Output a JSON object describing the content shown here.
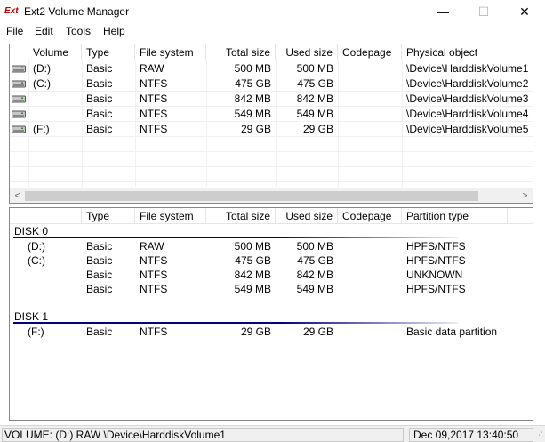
{
  "window": {
    "app_icon_text": "Ext",
    "title": "Ext2 Volume Manager",
    "min_glyph": "—",
    "max_glyph": "☐",
    "close_glyph": "✕"
  },
  "menu": [
    "File",
    "Edit",
    "Tools",
    "Help"
  ],
  "volumes": {
    "columns": [
      "Volume",
      "Type",
      "File system",
      "Total size",
      "Used size",
      "Codepage",
      "Physical object"
    ],
    "rows": [
      {
        "volume": "(D:)",
        "type": "Basic",
        "fs": "RAW",
        "total": "500 MB",
        "used": "500 MB",
        "codepage": "",
        "physical": "\\Device\\HarddiskVolume1"
      },
      {
        "volume": "(C:)",
        "type": "Basic",
        "fs": "NTFS",
        "total": "475 GB",
        "used": "475 GB",
        "codepage": "",
        "physical": "\\Device\\HarddiskVolume2"
      },
      {
        "volume": "",
        "type": "Basic",
        "fs": "NTFS",
        "total": "842 MB",
        "used": "842 MB",
        "codepage": "",
        "physical": "\\Device\\HarddiskVolume3"
      },
      {
        "volume": "",
        "type": "Basic",
        "fs": "NTFS",
        "total": "549 MB",
        "used": "549 MB",
        "codepage": "",
        "physical": "\\Device\\HarddiskVolume4"
      },
      {
        "volume": "(F:)",
        "type": "Basic",
        "fs": "NTFS",
        "total": "29 GB",
        "used": "29 GB",
        "codepage": "",
        "physical": "\\Device\\HarddiskVolume5"
      }
    ]
  },
  "scroll": {
    "left_arrow": "<",
    "right_arrow": ">"
  },
  "disks": {
    "columns": [
      "",
      "Type",
      "File system",
      "Total size",
      "Used size",
      "Codepage",
      "Partition type"
    ],
    "groups": [
      {
        "name": "DISK 0",
        "accent": "#000080",
        "partitions": [
          {
            "volume": "(D:)",
            "type": "Basic",
            "fs": "RAW",
            "total": "500 MB",
            "used": "500 MB",
            "codepage": "",
            "ptype": "HPFS/NTFS"
          },
          {
            "volume": "(C:)",
            "type": "Basic",
            "fs": "NTFS",
            "total": "475 GB",
            "used": "475 GB",
            "codepage": "",
            "ptype": "HPFS/NTFS"
          },
          {
            "volume": "",
            "type": "Basic",
            "fs": "NTFS",
            "total": "842 MB",
            "used": "842 MB",
            "codepage": "",
            "ptype": "UNKNOWN"
          },
          {
            "volume": "",
            "type": "Basic",
            "fs": "NTFS",
            "total": "549 MB",
            "used": "549 MB",
            "codepage": "",
            "ptype": "HPFS/NTFS"
          }
        ]
      },
      {
        "name": "DISK 1",
        "accent": "#000080",
        "partitions": [
          {
            "volume": "(F:)",
            "type": "Basic",
            "fs": "NTFS",
            "total": "29 GB",
            "used": "29 GB",
            "codepage": "",
            "ptype": "Basic data partition"
          }
        ]
      }
    ]
  },
  "status": {
    "left": "VOLUME: (D:) RAW \\Device\\HarddiskVolume1",
    "right": "Dec 09,2017 13:40:50",
    "grip": "⋰"
  }
}
